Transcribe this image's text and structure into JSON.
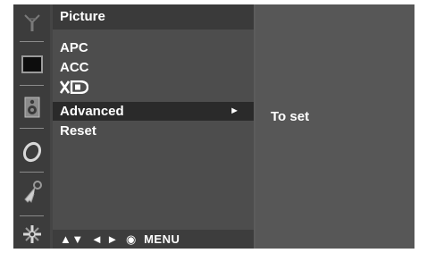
{
  "menu": {
    "title": "Picture",
    "items": [
      {
        "label": "APC"
      },
      {
        "label": "ACC"
      },
      {
        "label": "XD"
      },
      {
        "label": "Advanced",
        "selected": true,
        "has_submenu": true
      },
      {
        "label": "Reset"
      }
    ],
    "submenu_arrow": "►"
  },
  "nav_hint": "▲▼  ◄ ►  ◉  MENU",
  "description": "To set",
  "icons": [
    "antenna-icon",
    "picture-icon",
    "speaker-icon",
    "clock-icon",
    "key-icon",
    "settings-icon"
  ]
}
